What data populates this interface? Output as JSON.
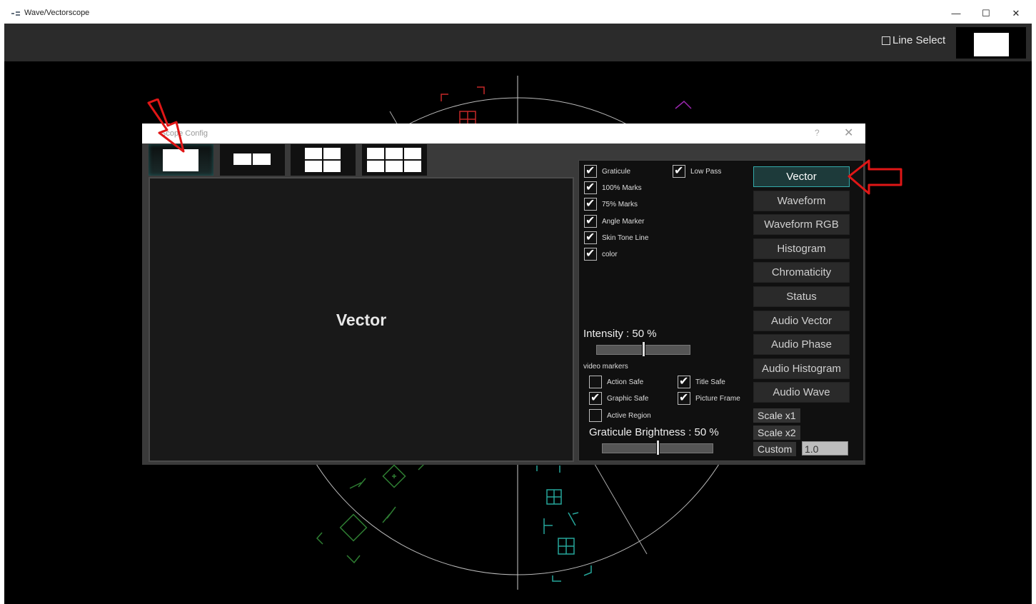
{
  "window": {
    "title": "Wave/Vectorscope",
    "min": "—",
    "max": "☐",
    "close": "✕"
  },
  "toolbar": {
    "line_select_label": "Line Select"
  },
  "dialog": {
    "title": "Scope Config",
    "help": "?",
    "close": "✕",
    "preview_label": "Vector",
    "options": [
      {
        "label": "Graticule",
        "checked": true
      },
      {
        "label": "Low Pass",
        "checked": true
      },
      {
        "label": "100% Marks",
        "checked": true
      },
      {
        "label": "75% Marks",
        "checked": true
      },
      {
        "label": "Angle Marker",
        "checked": true
      },
      {
        "label": "Skin Tone Line",
        "checked": true
      },
      {
        "label": "color",
        "checked": true
      }
    ],
    "intensity_label": "Intensity : 50 %",
    "intensity_value": 0.5,
    "video_markers_label": "video markers",
    "markers": [
      {
        "label": "Action Safe",
        "checked": false
      },
      {
        "label": "Title Safe",
        "checked": true
      },
      {
        "label": "Graphic Safe",
        "checked": true
      },
      {
        "label": "Picture Frame",
        "checked": true
      },
      {
        "label": "Active Region",
        "checked": false
      }
    ],
    "graticule_brightness_label": "Graticule Brightness : 50 %",
    "graticule_brightness_value": 0.5,
    "scope_types": [
      "Vector",
      "Waveform",
      "Waveform RGB",
      "Histogram",
      "Chromaticity",
      "Status",
      "Audio Vector",
      "Audio Phase",
      "Audio Histogram",
      "Audio Wave"
    ],
    "selected_scope": "Vector",
    "scale_x1": "Scale x1",
    "scale_x2": "Scale x2",
    "custom_label": "Custom",
    "custom_value": "1.0"
  }
}
